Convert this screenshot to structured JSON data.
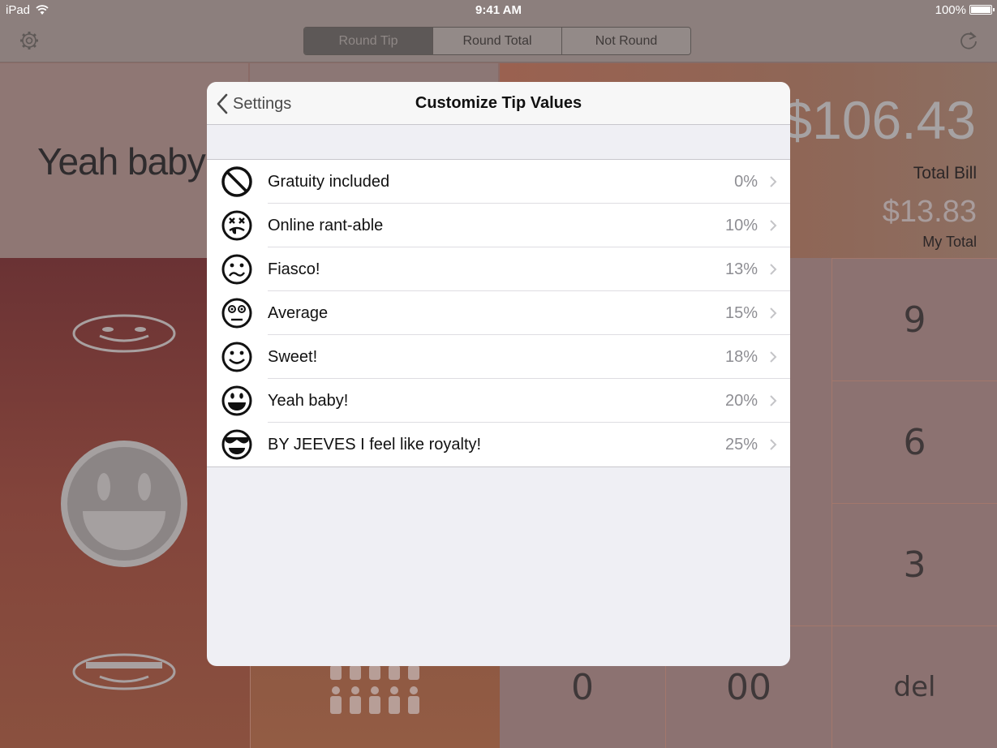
{
  "status_bar": {
    "carrier": "iPad",
    "time": "9:41 AM",
    "battery": "100%"
  },
  "toolbar": {
    "segments": [
      "Round Tip",
      "Round Total",
      "Not Round"
    ],
    "selected_segment": "Round Tip",
    "settings_icon": "gear-icon",
    "refresh_icon": "refresh-icon"
  },
  "summary": {
    "mood": "Yeah baby!",
    "total_bill": "$106.43",
    "total_bill_label": "Total Bill",
    "my_total": "$13.83",
    "my_total_label": "My Total"
  },
  "keypad": {
    "keys": [
      "9",
      "6",
      "3",
      "0",
      "00",
      "del"
    ]
  },
  "modal": {
    "back_label": "Settings",
    "title": "Customize Tip Values",
    "rows": [
      {
        "label": "Gratuity included",
        "value": "0%",
        "icon": "no-sign-icon"
      },
      {
        "label": "Online rant-able",
        "value": "10%",
        "icon": "dizzy-face-icon"
      },
      {
        "label": "Fiasco!",
        "value": "13%",
        "icon": "wavy-mouth-face-icon"
      },
      {
        "label": "Average",
        "value": "15%",
        "icon": "neutral-face-icon"
      },
      {
        "label": "Sweet!",
        "value": "18%",
        "icon": "smile-face-icon"
      },
      {
        "label": "Yeah baby!",
        "value": "20%",
        "icon": "grin-face-icon"
      },
      {
        "label": "BY JEEVES I feel like royalty!",
        "value": "25%",
        "icon": "sunglasses-face-icon"
      }
    ]
  },
  "colors": {
    "accent": "#4a4a4a",
    "modal_bg": "#efeff4",
    "value_gray": "#8e8e93"
  }
}
